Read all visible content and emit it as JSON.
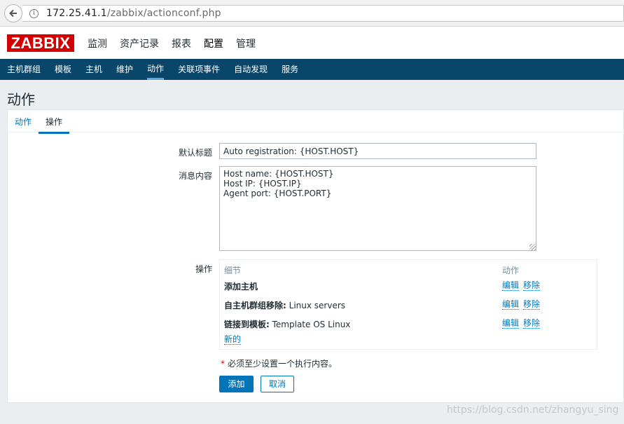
{
  "browser": {
    "url_host": "172.25.41.1",
    "url_path": "/zabbix/actionconf.php"
  },
  "header": {
    "logo": "ZABBIX",
    "menu": [
      {
        "label": "监测"
      },
      {
        "label": "资产记录"
      },
      {
        "label": "报表"
      },
      {
        "label": "配置",
        "active": true
      },
      {
        "label": "管理"
      }
    ]
  },
  "subnav": {
    "items": [
      {
        "label": "主机群组"
      },
      {
        "label": "模板"
      },
      {
        "label": "主机"
      },
      {
        "label": "维护"
      },
      {
        "label": "动作",
        "active": true
      },
      {
        "label": "关联项事件"
      },
      {
        "label": "自动发现"
      },
      {
        "label": "服务"
      }
    ]
  },
  "page": {
    "title": "动作"
  },
  "tabs": {
    "action": "动作",
    "operations": "操作"
  },
  "form": {
    "default_subject_label": "默认标题",
    "default_subject_value": "Auto registration: {HOST.HOST}",
    "message_label": "消息内容",
    "message_value": "Host name: {HOST.HOST}\nHost IP: {HOST.IP}\nAgent port: {HOST.PORT}",
    "operations_label": "操作",
    "ops_col_details": "细节",
    "ops_col_action": "动作",
    "operations": [
      {
        "bold": "添加主机",
        "rest": ""
      },
      {
        "bold": "自主机群组移除:",
        "rest": " Linux servers"
      },
      {
        "bold": "链接到模板:",
        "rest": " Template OS Linux"
      }
    ],
    "edit_label": "编辑",
    "remove_label": "移除",
    "new_label": "新的",
    "note_required": "*",
    "note_text": "必须至少设置一个执行内容。",
    "add_button": "添加",
    "cancel_button": "取消"
  },
  "watermark": "https://blog.csdn.net/zhangyu_sing",
  "colors": {
    "brand_red": "#d40000",
    "nav_blue": "#0a466a",
    "link_blue": "#0275b8"
  }
}
